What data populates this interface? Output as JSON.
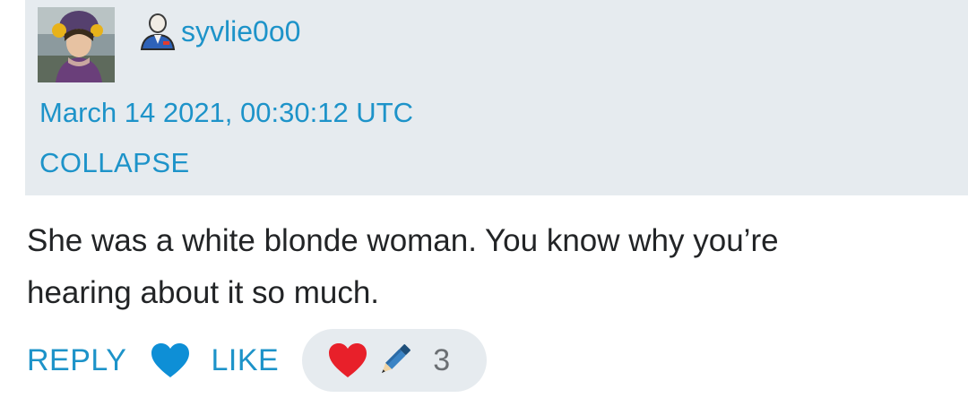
{
  "comment": {
    "author": {
      "username": "syvlie0o0",
      "avatar_icon": "user-avatar-photo",
      "role_icon": "moderator-person-icon"
    },
    "timestamp": "March 14 2021, 00:30:12 UTC",
    "collapse_label": "COLLAPSE",
    "body_lines": [
      "She was a white blonde woman. You know why you’re",
      "hearing about it so much."
    ]
  },
  "actions": {
    "reply_label": "REPLY",
    "like_label": "LIKE",
    "like_icon": "heart-icon",
    "reactions": {
      "icons": [
        "red-heart-icon",
        "pencil-icon"
      ],
      "count": "3"
    }
  },
  "colors": {
    "link": "#1d93c9",
    "header_background": "#e6ebef",
    "body_text": "#222426",
    "like_heart": "#0e8fd6",
    "reaction_heart": "#e8202a",
    "count_text": "#6b6f73"
  }
}
